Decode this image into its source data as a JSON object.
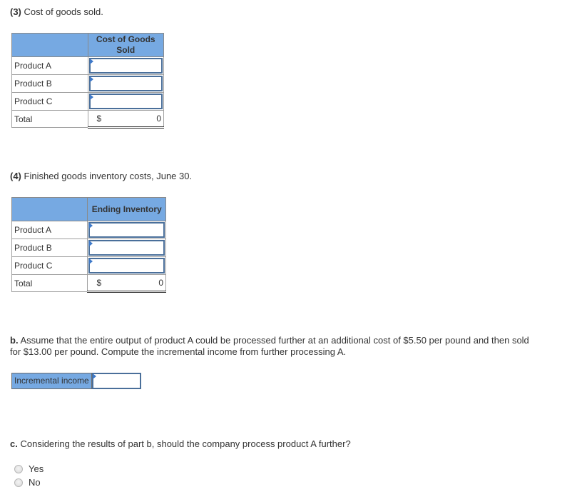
{
  "section3": {
    "number": "(3)",
    "title": "Cost of goods sold.",
    "table": {
      "column_header": "Cost of Goods Sold",
      "rows": [
        {
          "label": "Product A",
          "value": ""
        },
        {
          "label": "Product B",
          "value": ""
        },
        {
          "label": "Product C",
          "value": ""
        }
      ],
      "total": {
        "label": "Total",
        "currency": "$",
        "value": "0"
      }
    }
  },
  "section4": {
    "number": "(4)",
    "title": "Finished goods inventory costs, June 30.",
    "table": {
      "column_header": "Ending Inventory",
      "rows": [
        {
          "label": "Product A",
          "value": ""
        },
        {
          "label": "Product B",
          "value": ""
        },
        {
          "label": "Product C",
          "value": ""
        }
      ],
      "total": {
        "label": "Total",
        "currency": "$",
        "value": "0"
      }
    }
  },
  "partB": {
    "letter": "b.",
    "line1": "Assume that the entire output of product A could be processed further at an additional cost of $5.50 per pound and then sold",
    "line2": "for $13.00 per pound. Compute the incremental income from further processing A.",
    "input_label": "Incremental income",
    "input_value": ""
  },
  "partC": {
    "letter": "c.",
    "question": "Considering the results of part b, should the company process product A further?",
    "options": [
      "Yes",
      "No"
    ]
  }
}
